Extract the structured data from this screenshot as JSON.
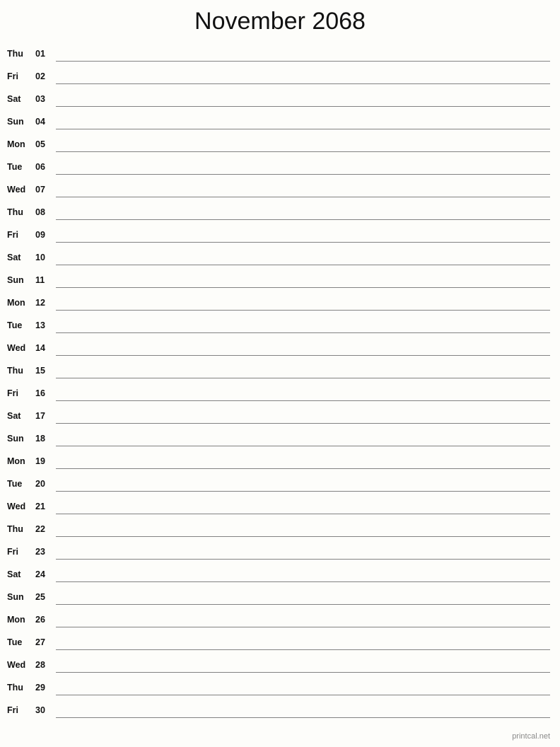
{
  "document": {
    "type": "printable-monthly-calendar",
    "title": "November 2068",
    "month": "November",
    "year": "2068",
    "footer_credit": "printcal.net"
  },
  "columns": {
    "weekday_header": "",
    "daynumber_header": "",
    "notes_header": ""
  },
  "days": [
    {
      "weekday": "Thu",
      "number": "01"
    },
    {
      "weekday": "Fri",
      "number": "02"
    },
    {
      "weekday": "Sat",
      "number": "03"
    },
    {
      "weekday": "Sun",
      "number": "04"
    },
    {
      "weekday": "Mon",
      "number": "05"
    },
    {
      "weekday": "Tue",
      "number": "06"
    },
    {
      "weekday": "Wed",
      "number": "07"
    },
    {
      "weekday": "Thu",
      "number": "08"
    },
    {
      "weekday": "Fri",
      "number": "09"
    },
    {
      "weekday": "Sat",
      "number": "10"
    },
    {
      "weekday": "Sun",
      "number": "11"
    },
    {
      "weekday": "Mon",
      "number": "12"
    },
    {
      "weekday": "Tue",
      "number": "13"
    },
    {
      "weekday": "Wed",
      "number": "14"
    },
    {
      "weekday": "Thu",
      "number": "15"
    },
    {
      "weekday": "Fri",
      "number": "16"
    },
    {
      "weekday": "Sat",
      "number": "17"
    },
    {
      "weekday": "Sun",
      "number": "18"
    },
    {
      "weekday": "Mon",
      "number": "19"
    },
    {
      "weekday": "Tue",
      "number": "20"
    },
    {
      "weekday": "Wed",
      "number": "21"
    },
    {
      "weekday": "Thu",
      "number": "22"
    },
    {
      "weekday": "Fri",
      "number": "23"
    },
    {
      "weekday": "Sat",
      "number": "24"
    },
    {
      "weekday": "Sun",
      "number": "25"
    },
    {
      "weekday": "Mon",
      "number": "26"
    },
    {
      "weekday": "Tue",
      "number": "27"
    },
    {
      "weekday": "Wed",
      "number": "28"
    },
    {
      "weekday": "Thu",
      "number": "29"
    },
    {
      "weekday": "Fri",
      "number": "30"
    }
  ],
  "colors": {
    "page_background": "#fdfdfa",
    "text": "#111111",
    "rule_line": "#828282",
    "footer_text": "#8a8a8a"
  }
}
